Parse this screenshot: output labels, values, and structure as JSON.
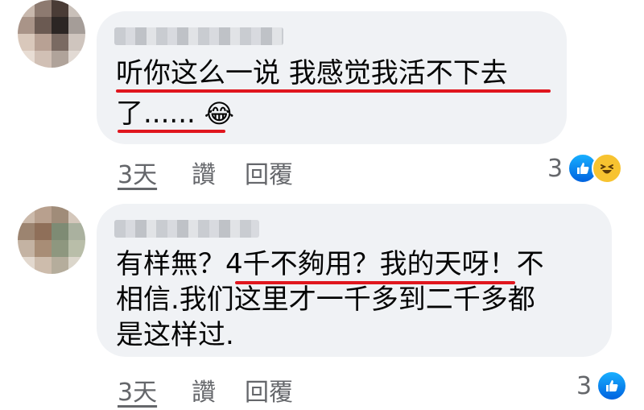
{
  "comments": [
    {
      "lines": [
        "听你这么一说 我感觉我活不下去",
        "了......"
      ],
      "emoji": "😂",
      "time": "3天",
      "like_label": "讚",
      "reply_label": "回覆",
      "reaction_count": "3",
      "reactions": [
        "like-icon",
        "haha-icon"
      ]
    },
    {
      "lines": [
        "有样無？4千不夠用？我的天呀！不",
        "相信.我们这里才一千多到二千多都",
        "是这样过."
      ],
      "time": "3天",
      "like_label": "讚",
      "reply_label": "回覆",
      "reaction_count": "3",
      "reactions": [
        "like-icon"
      ]
    }
  ],
  "colors": {
    "bubble": "#f0f2f5",
    "underline": "#e0161e",
    "meta_text": "#65676b",
    "like_blue": "#1877f2",
    "haha_yellow": "#f7c330"
  }
}
